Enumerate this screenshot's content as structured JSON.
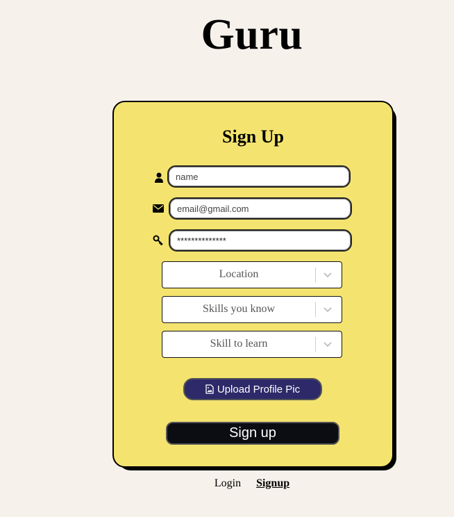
{
  "brand": {
    "title": "Guru"
  },
  "signup_form": {
    "title": "Sign Up",
    "name": {
      "placeholder": "name",
      "icon": "user-icon"
    },
    "email": {
      "placeholder": "email@gmail.com",
      "icon": "envelope-icon"
    },
    "password": {
      "value": "**************",
      "icon": "key-icon"
    },
    "location_select": {
      "value": "Location"
    },
    "skills_known_select": {
      "value": "Skills you know"
    },
    "skill_to_learn_select": {
      "value": "Skill to learn"
    },
    "upload_button": {
      "label": "Upload Profile Pic",
      "icon": "image-file-icon"
    },
    "submit_button": {
      "label": "Sign up"
    }
  },
  "bottom_nav": {
    "login": "Login",
    "signup": "Signup"
  },
  "colors": {
    "page_background": "#f6f1eb",
    "card_background": "#f4e46f",
    "upload_button": "#2e2969",
    "submit_button": "#0b0d12"
  }
}
